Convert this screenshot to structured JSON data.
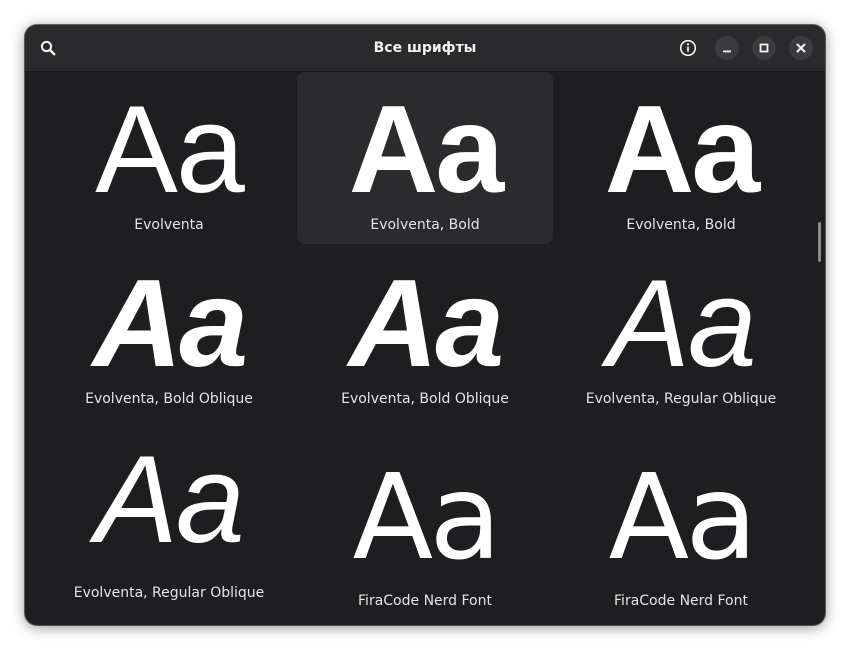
{
  "window": {
    "title": "Все шрифты"
  },
  "header": {
    "search_icon": "search-icon",
    "info_icon": "info-icon",
    "minimize_icon": "minimize-icon",
    "maximize_icon": "maximize-icon",
    "close_icon": "close-icon"
  },
  "fonts": [
    {
      "sample": "Aa",
      "name": "Evolventa"
    },
    {
      "sample": "Aa",
      "name": "Evolventa, Bold"
    },
    {
      "sample": "Aa",
      "name": "Evolventa, Bold"
    },
    {
      "sample": "Aa",
      "name": "Evolventa, Bold Oblique"
    },
    {
      "sample": "Aa",
      "name": "Evolventa, Bold Oblique"
    },
    {
      "sample": "Aa",
      "name": "Evolventa, Regular Oblique"
    },
    {
      "sample": "Aa",
      "name": "Evolventa, Regular Oblique"
    },
    {
      "sample": "Aa",
      "name": "FiraCode Nerd Font"
    },
    {
      "sample": "Aa",
      "name": "FiraCode Nerd Font"
    }
  ],
  "colors": {
    "window_bg": "#1e1e20",
    "headerbar_bg": "#2a2a2c",
    "selected_cell_bg": "#2b2b2e",
    "text": "#ffffff"
  }
}
